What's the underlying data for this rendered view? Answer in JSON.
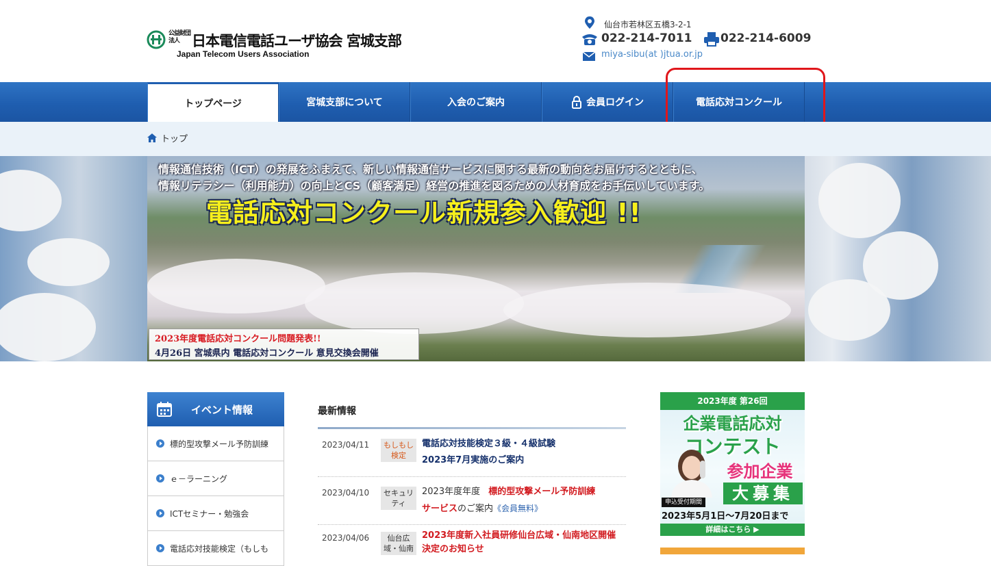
{
  "header": {
    "logo_small": "公益財団法人",
    "logo_title": "日本電信電話ユーザ協会 宮城支部",
    "logo_subtitle": "Japan Telecom Users Association",
    "address": "仙台市若林区五橋3-2-1",
    "tel": "022-214-7011",
    "fax": "022-214-6009",
    "email": "miya-sibu(at )jtua.or.jp"
  },
  "nav": {
    "items": [
      {
        "label": "トップページ"
      },
      {
        "label": "宮城支部について"
      },
      {
        "label": "入会のご案内"
      },
      {
        "label": "会員ログイン"
      },
      {
        "label": "電話応対コンクール"
      }
    ]
  },
  "breadcrumb": {
    "home": "トップ"
  },
  "hero": {
    "line1": "情報通信技術（ICT）の発展をふまえて、新しい情報通信サービスに関する最新の動向をお届けするとともに、",
    "line2": "情報リテラシー（利用能力）の向上とCS（顧客満足）経営の推進を図るための人材育成をお手伝いしています。",
    "headline": "電話応対コンクール新規参入歓迎 !!",
    "notice1": "2023年度電話応対コンクール問題発表!!",
    "notice2": "4月26日 宮城県内 電話応対コンクール 意見交換会開催"
  },
  "sidebar": {
    "heading": "イベント情報",
    "items": [
      {
        "label": "標的型攻撃メール予防訓練"
      },
      {
        "label": "ｅ－ラーニング"
      },
      {
        "label": "ICTセミナー・勉強会"
      },
      {
        "label": "電話応対技能検定（もしも"
      }
    ]
  },
  "news": {
    "title": "最新情報",
    "rows": [
      {
        "date": "2023/04/11",
        "category": "もしもし検定",
        "title_l1": "電話応対技能検定３級・４級試験",
        "title_l2": "2023年7月実施のご案内"
      },
      {
        "date": "2023/04/10",
        "category": "セキュリティ",
        "prefix": "2023年度年度",
        "highlight": "標的型攻撃メール予防訓練",
        "highlight2": "サービス",
        "suffix": "のご案内",
        "link": "《会員無料》"
      },
      {
        "date": "2023/04/06",
        "category": "仙台広域・仙南",
        "title_l1": "2023年度新入社員研修仙台広域・仙南地区開催",
        "title_l2": "決定のお知らせ"
      }
    ]
  },
  "banner": {
    "top": "2023年度 第26回",
    "line1": "企業電話応対",
    "line2": "コンテスト",
    "line3": "参加企業",
    "recruit": "大募集",
    "period_label": "申込受付期間",
    "dates": "2023年5月1日～7月20日まで",
    "more": "詳細はこちら ▶"
  },
  "colors": {
    "nav_blue": "#1f5eb0",
    "highlight_red": "#e0161b",
    "banner_green": "#2aa14a",
    "hero_yellow": "#f6ef1c"
  }
}
